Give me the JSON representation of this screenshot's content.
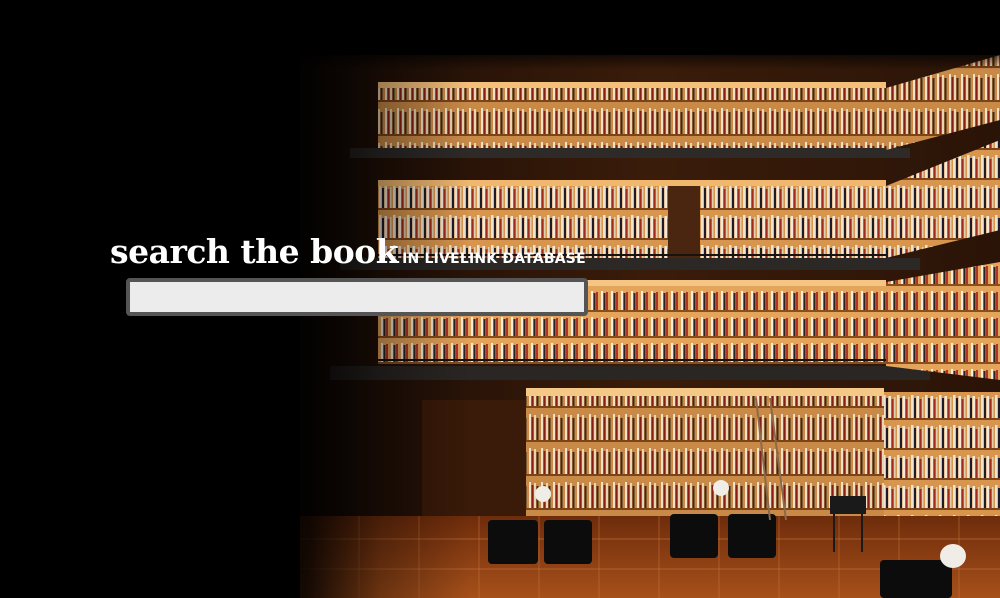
{
  "search": {
    "heading_main": "search the book",
    "heading_sub": "IN LIVELINK DATABASE",
    "value": "",
    "placeholder": ""
  },
  "background": {
    "subject": "multi-level library interior with illuminated bookshelves",
    "colors": {
      "page": "#000000",
      "wood_light": "#e7a55a",
      "wood_dark": "#6a3512",
      "floor": "#8a3d12"
    }
  }
}
